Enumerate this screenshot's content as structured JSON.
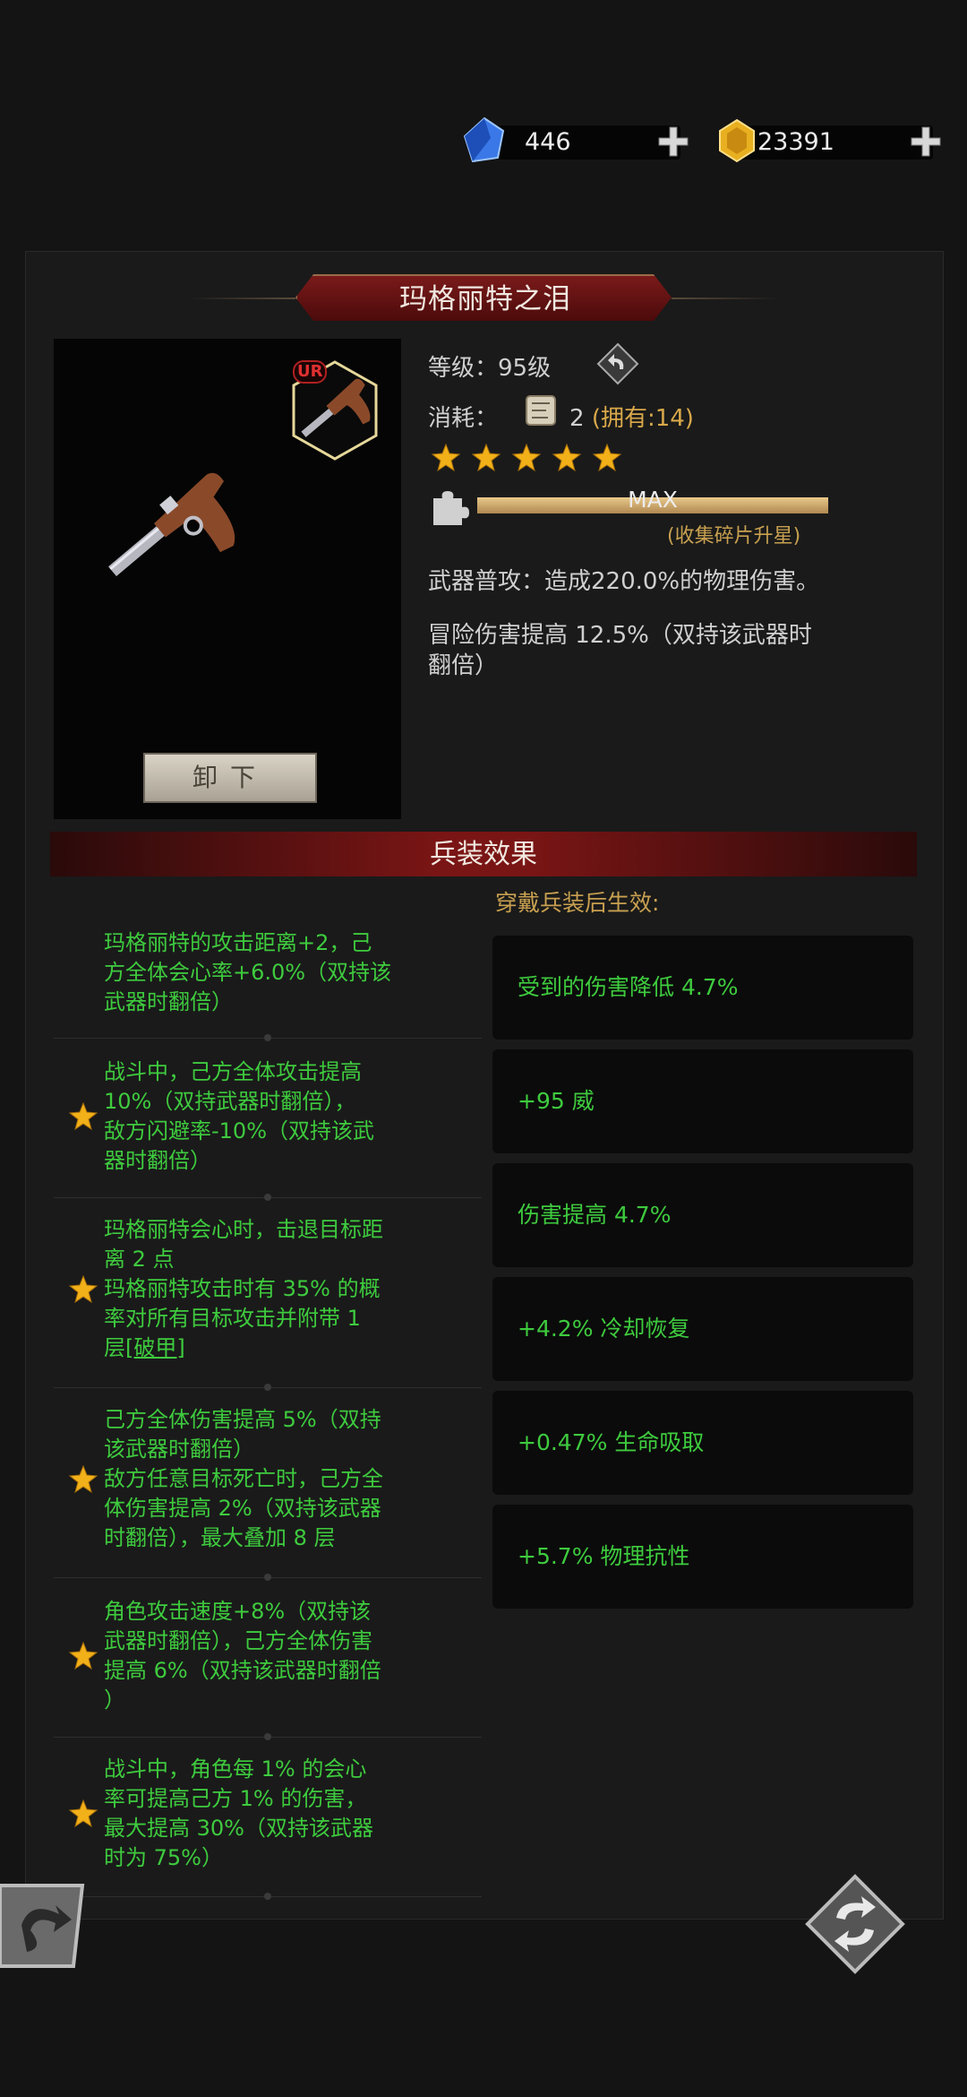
{
  "currency": {
    "gems": "446",
    "gold": "23391"
  },
  "item": {
    "name": "玛格丽特之泪",
    "badge": "UR",
    "level_label": "等级：",
    "level_value": "95级",
    "cost_label": "消耗：",
    "cost_value": "2",
    "owned": "(拥有:14)",
    "stars": 5,
    "progress_text": "MAX",
    "progress_fraction": 1.0,
    "progress_hint": "(收集碎片升星)",
    "desc1": "武器普攻：造成220.0%的物理伤害。",
    "desc2_line1": "冒险伤害提高 12.5%（双持该武器时",
    "desc2_line2": "翻倍）",
    "unequip_label": "卸下"
  },
  "section": {
    "title": "兵装效果",
    "after_label": "穿戴兵装后生效:"
  },
  "effects": [
    {
      "lines": [
        "玛格丽特的攻击距离+2，己",
        "方全体会心率+6.0%（双持该",
        "武器时翻倍）"
      ],
      "star": false
    },
    {
      "lines": [
        "战斗中，己方全体攻击提高",
        "10%（双持武器时翻倍），",
        "敌方闪避率-10%（双持该武",
        "器时翻倍）"
      ],
      "star": true
    },
    {
      "lines": [
        "玛格丽特会心时，击退目标距",
        "离 2 点",
        "玛格丽特攻击时有 35% 的概",
        "率对所有目标攻击并附带 1",
        "层[破甲]"
      ],
      "star": true
    },
    {
      "lines": [
        "己方全体伤害提高 5%（双持",
        "该武器时翻倍）",
        "敌方任意目标死亡时，己方全",
        "体伤害提高 2%（双持该武器",
        "时翻倍），最大叠加 8 层"
      ],
      "star": true
    },
    {
      "lines": [
        "角色攻击速度+8%（双持该",
        "武器时翻倍），己方全体伤害",
        "提高 6%（双持该武器时翻倍",
        "）"
      ],
      "star": true
    },
    {
      "lines": [
        "战斗中，角色每 1% 的会心",
        "率可提高己方 1% 的伤害，",
        "最大提高 30%（双持该武器",
        "时为 75%）"
      ],
      "star": true
    }
  ],
  "stats": [
    "受到的伤害降低 4.7%",
    "+95 威",
    "伤害提高 4.7%",
    "+4.2% 冷却恢复",
    "+0.47% 生命吸取",
    "+5.7% 物理抗性"
  ],
  "colors": {
    "effect_green": "#3ecb3e",
    "owned_gold": "#d8a84a",
    "title_red": "#7a1a1a"
  }
}
